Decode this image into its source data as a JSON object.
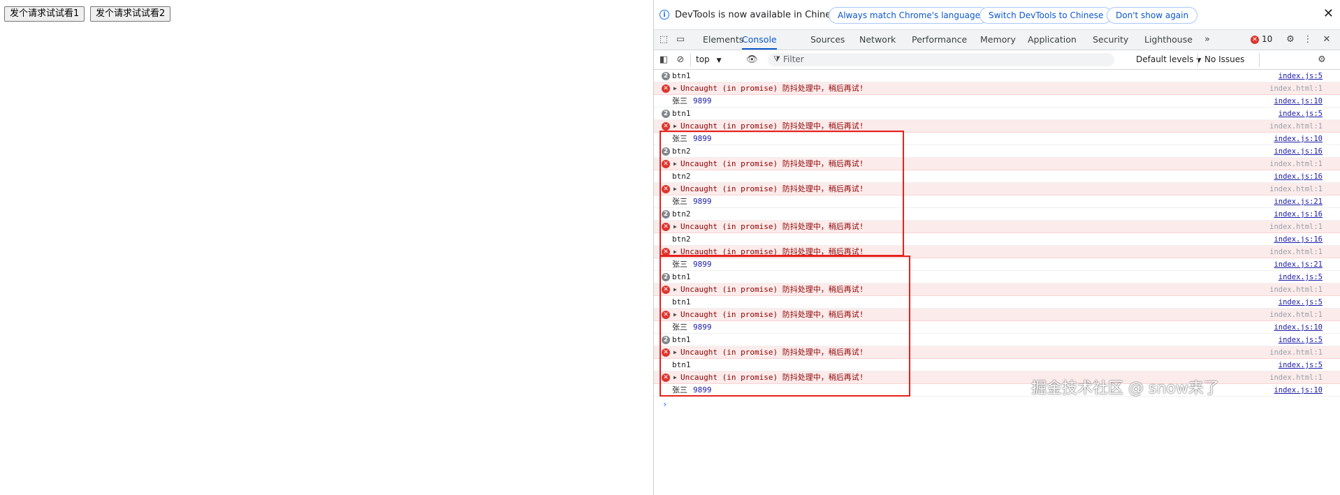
{
  "page": {
    "buttons": [
      "发个请求试试看1",
      "发个请求试试看2"
    ]
  },
  "infobar": {
    "text": "DevTools is now available in Chinese!",
    "actions": [
      "Always match Chrome's language",
      "Switch DevTools to Chinese",
      "Don't show again"
    ]
  },
  "tabs": {
    "items": [
      "Elements",
      "Console",
      "Sources",
      "Network",
      "Performance",
      "Memory",
      "Application",
      "Security",
      "Lighthouse"
    ],
    "active": "Console",
    "error_count": "10"
  },
  "toolbar": {
    "context": "top",
    "filter_placeholder": "Filter",
    "levels": "Default levels",
    "issues": "No Issues"
  },
  "console": {
    "rows": [
      {
        "kind": "log",
        "repeat": "2",
        "text": "btn1",
        "extra": "",
        "source": "index.js:5"
      },
      {
        "kind": "error",
        "text": "Uncaught (in promise) 防抖处理中，稍后再试!",
        "source": "index.html:1"
      },
      {
        "kind": "log",
        "repeat": "",
        "text": "张三",
        "extra": "9899",
        "source": "index.js:10"
      },
      {
        "kind": "log",
        "repeat": "2",
        "text": "btn1",
        "extra": "",
        "source": "index.js:5"
      },
      {
        "kind": "error",
        "text": "Uncaught (in promise) 防抖处理中，稍后再试!",
        "source": "index.html:1"
      },
      {
        "kind": "log",
        "repeat": "",
        "text": "张三",
        "extra": "9899",
        "source": "index.js:10"
      },
      {
        "kind": "log",
        "repeat": "2",
        "text": "btn2",
        "extra": "",
        "source": "index.js:16"
      },
      {
        "kind": "error",
        "text": "Uncaught (in promise) 防抖处理中，稍后再试!",
        "source": "index.html:1"
      },
      {
        "kind": "log",
        "repeat": "",
        "text": "btn2",
        "extra": "",
        "source": "index.js:16"
      },
      {
        "kind": "error",
        "text": "Uncaught (in promise) 防抖处理中，稍后再试!",
        "source": "index.html:1"
      },
      {
        "kind": "log",
        "repeat": "",
        "text": "张三",
        "extra": "9899",
        "source": "index.js:21"
      },
      {
        "kind": "log",
        "repeat": "2",
        "text": "btn2",
        "extra": "",
        "source": "index.js:16"
      },
      {
        "kind": "error",
        "text": "Uncaught (in promise) 防抖处理中，稍后再试!",
        "source": "index.html:1"
      },
      {
        "kind": "log",
        "repeat": "",
        "text": "btn2",
        "extra": "",
        "source": "index.js:16"
      },
      {
        "kind": "error",
        "text": "Uncaught (in promise) 防抖处理中，稍后再试!",
        "source": "index.html:1"
      },
      {
        "kind": "log",
        "repeat": "",
        "text": "张三",
        "extra": "9899",
        "source": "index.js:21"
      },
      {
        "kind": "log",
        "repeat": "2",
        "text": "btn1",
        "extra": "",
        "source": "index.js:5"
      },
      {
        "kind": "error",
        "text": "Uncaught (in promise) 防抖处理中，稍后再试!",
        "source": "index.html:1"
      },
      {
        "kind": "log",
        "repeat": "",
        "text": "btn1",
        "extra": "",
        "source": "index.js:5"
      },
      {
        "kind": "error",
        "text": "Uncaught (in promise) 防抖处理中，稍后再试!",
        "source": "index.html:1"
      },
      {
        "kind": "log",
        "repeat": "",
        "text": "张三",
        "extra": "9899",
        "source": "index.js:10"
      },
      {
        "kind": "log",
        "repeat": "2",
        "text": "btn1",
        "extra": "",
        "source": "index.js:5"
      },
      {
        "kind": "error",
        "text": "Uncaught (in promise) 防抖处理中，稍后再试!",
        "source": "index.html:1"
      },
      {
        "kind": "log",
        "repeat": "",
        "text": "btn1",
        "extra": "",
        "source": "index.js:5"
      },
      {
        "kind": "error",
        "text": "Uncaught (in promise) 防抖处理中，稍后再试!",
        "source": "index.html:1"
      },
      {
        "kind": "log",
        "repeat": "",
        "text": "张三",
        "extra": "9899",
        "source": "index.js:10"
      }
    ],
    "prompt_symbol": "›"
  },
  "watermark": "掘金技术社区 @ snow来了",
  "colors": {
    "accent": "#0b57d0",
    "error_bg": "#fcebeb",
    "error_icon": "#dc362e",
    "highlight_box": "#e5211d"
  }
}
